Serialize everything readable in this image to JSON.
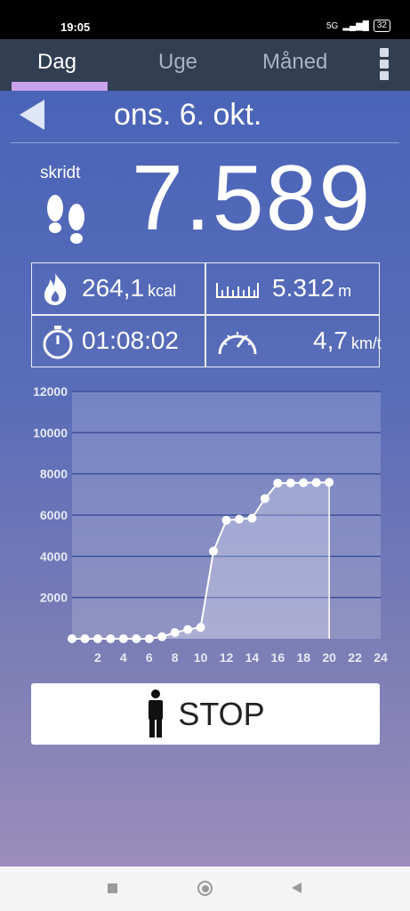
{
  "status_bar": {
    "time": "19:05",
    "network": "5G",
    "battery": "32"
  },
  "tabs": [
    {
      "label": "Dag",
      "active": true
    },
    {
      "label": "Uge",
      "active": false
    },
    {
      "label": "Måned",
      "active": false
    }
  ],
  "date": "ons. 6. okt.",
  "steps": {
    "label": "skridt",
    "value": "7.589"
  },
  "stats": {
    "calories": {
      "value": "264,1",
      "unit": "kcal"
    },
    "distance": {
      "value": "5.312",
      "unit": "m"
    },
    "duration": {
      "value": "01:08:02"
    },
    "speed": {
      "value": "4,7",
      "unit": "km/t"
    }
  },
  "stop_button": {
    "label": "STOP"
  },
  "colors": {
    "accent": "#c9a2ec",
    "tabbar": "#323e52",
    "line": "#ffffff"
  },
  "chart_data": {
    "type": "area",
    "x": [
      0,
      1,
      2,
      3,
      4,
      5,
      6,
      7,
      8,
      9,
      10,
      11,
      12,
      13,
      14,
      15,
      16,
      17,
      18,
      19,
      20
    ],
    "values": [
      0,
      0,
      0,
      0,
      0,
      0,
      0,
      100,
      300,
      450,
      550,
      4250,
      5750,
      5800,
      5850,
      6800,
      7550,
      7560,
      7570,
      7580,
      7589
    ],
    "xlim": [
      0,
      24
    ],
    "ylim": [
      0,
      12000
    ],
    "x_ticks": [
      2,
      4,
      6,
      8,
      10,
      12,
      14,
      16,
      18,
      20,
      22,
      24
    ],
    "y_ticks": [
      2000,
      4000,
      6000,
      8000,
      10000,
      12000
    ],
    "grid": true
  }
}
